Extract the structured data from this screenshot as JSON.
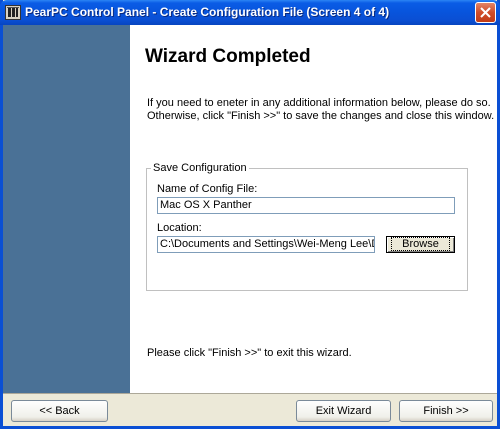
{
  "window": {
    "title": "PearPC Control Panel - Create Configuration File (Screen 4 of 4)"
  },
  "icons": {
    "app": "pearpc-app-icon",
    "close": "close-icon"
  },
  "colors": {
    "titlebar": "#0a4fd4",
    "side_panel": "#4a7196",
    "content_bg": "#ffffff",
    "dialog_bg": "#ece9d8"
  },
  "main": {
    "heading": "Wizard Completed",
    "intro_line1": "If you need to eneter in any additional information below, please do so.",
    "intro_line2": "Otherwise, click \"Finish >>\" to save the changes and close this window.",
    "group_title": "Save Configuration",
    "config_name_label": "Name of Config File:",
    "config_name_value": "Mac OS X Panther",
    "location_label": "Location:",
    "location_value": "C:\\Documents and Settings\\Wei-Meng Lee\\Desktop\\",
    "browse_label": "Browse",
    "footer_note": "Please click \"Finish >>\" to exit this wizard."
  },
  "buttons": {
    "back": "<< Back",
    "exit": "Exit Wizard",
    "finish": "Finish >>"
  }
}
